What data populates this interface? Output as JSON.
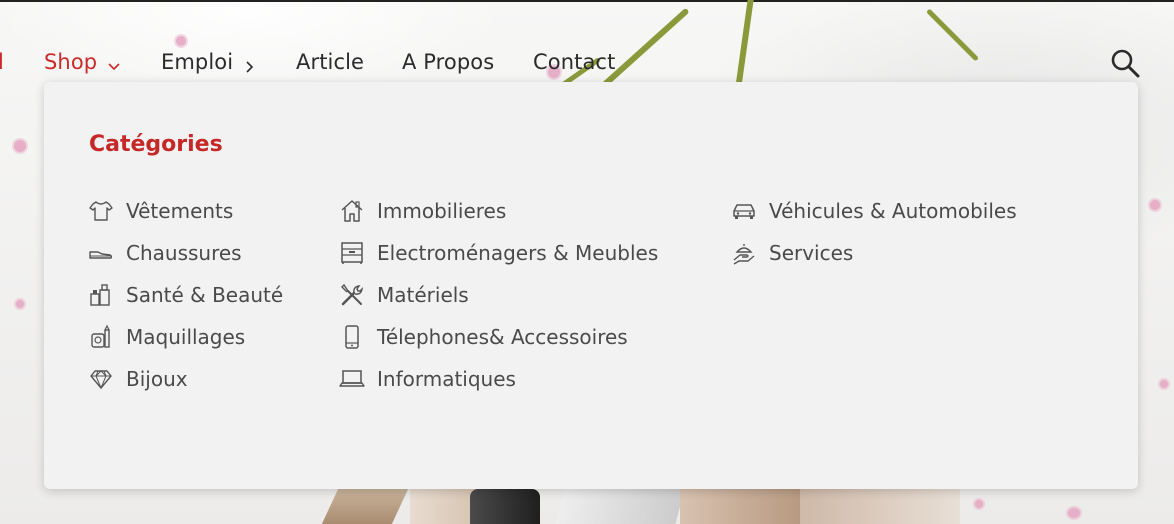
{
  "nav": {
    "partial_item": "l",
    "items": [
      {
        "label": "Shop",
        "active": true,
        "indicator": "chevron-down-icon"
      },
      {
        "label": "Emploi",
        "active": false,
        "indicator": "chevron-right-icon"
      },
      {
        "label": "Article",
        "active": false
      },
      {
        "label": "A Propos",
        "active": false
      },
      {
        "label": "Contact",
        "active": false
      }
    ],
    "search_icon": "search-icon",
    "accent_color": "#cc2a2a"
  },
  "menu": {
    "title": "Catégories",
    "columns": [
      [
        {
          "label": "Vêtements",
          "icon": "shirt-icon"
        },
        {
          "label": "Chaussures",
          "icon": "shoe-icon"
        },
        {
          "label": "Santé & Beauté",
          "icon": "cosmetics-icon"
        },
        {
          "label": "Maquillages",
          "icon": "makeup-icon"
        },
        {
          "label": "Bijoux",
          "icon": "diamond-icon"
        }
      ],
      [
        {
          "label": "Immobilieres",
          "icon": "house-icon"
        },
        {
          "label": "Electroménagers & Meubles",
          "icon": "furniture-icon"
        },
        {
          "label": "Matériels",
          "icon": "tools-icon"
        },
        {
          "label": "Télephones& Accessoires",
          "icon": "phone-icon"
        },
        {
          "label": "Informatiques",
          "icon": "laptop-icon"
        }
      ],
      [
        {
          "label": "Véhicules & Automobiles",
          "icon": "car-icon"
        },
        {
          "label": "Services",
          "icon": "service-hand-icon"
        }
      ]
    ]
  }
}
